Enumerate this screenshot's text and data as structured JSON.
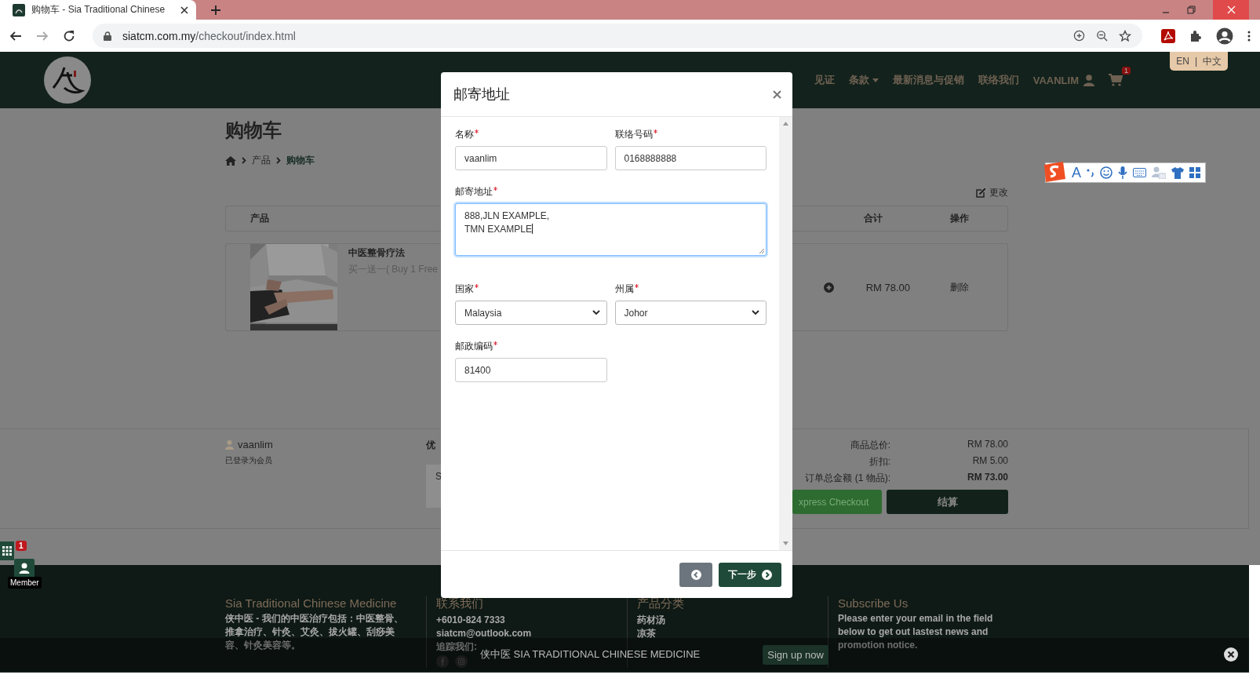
{
  "browser": {
    "tab_title": "购物车 - Sia Traditional Chinese",
    "url_host": "siatcm.com.my",
    "url_path": "/checkout/index.html"
  },
  "site_nav": {
    "items": [
      {
        "label": "见证",
        "dropdown": false
      },
      {
        "label": "条款",
        "dropdown": true
      },
      {
        "label": "最新消息与促销",
        "dropdown": false
      },
      {
        "label": "联络我们",
        "dropdown": false
      }
    ],
    "user": "VAANLIM",
    "cart_count": "1"
  },
  "language_switch": {
    "items": [
      "EN",
      "中文"
    ],
    "separator": "|"
  },
  "ime_toolbar": {
    "letter": "A"
  },
  "page": {
    "title": "购物车",
    "breadcrumb": [
      "产品",
      "购物车"
    ],
    "edit_link": "更改"
  },
  "cart_table": {
    "columns": [
      "产品",
      "合计",
      "操作"
    ],
    "rows": [
      {
        "name": "中医整骨疗法",
        "offer": "买一送一( Buy 1 Free",
        "total": "RM 78.00",
        "action": "删除"
      }
    ]
  },
  "summary": {
    "user": "vaanlim",
    "status": "已登录为会员",
    "coupon_label": "优",
    "coupon_box": "S",
    "lines": [
      {
        "label": "商品总价:",
        "value": "RM 78.00",
        "bold": false
      },
      {
        "label": "折扣:",
        "value": "RM 5.00",
        "bold": false
      },
      {
        "label": "订单总金额 (1 物品):",
        "value": "RM 73.00",
        "bold": true
      }
    ],
    "express_button": "xpress Checkout",
    "checkout_button": "结算"
  },
  "side_widget": {
    "badge": "1",
    "label": "Member"
  },
  "footer": {
    "columns": [
      {
        "title": "Sia Traditional Chinese Medicine",
        "lines": [
          "侠中医 - 我们的中医治疗包括：中医整骨、推拿治疗、针灸、艾灸、拔火罐、刮痧美容、针灸美容等。"
        ]
      },
      {
        "title": "联系我们",
        "lines": [
          "+6010-824 7333",
          "siatcm@outlook.com",
          "追踪我们:"
        ]
      },
      {
        "title": "产品分类",
        "lines": [
          "药材汤",
          "凉茶"
        ]
      },
      {
        "title": "Subscribe Us",
        "lines": [
          "Please enter your email in the field below to get out lastest news and promotion notice."
        ]
      }
    ]
  },
  "cookie_bar": {
    "text": "侠中医 SIA TRADITIONAL CHINESE MEDICINE",
    "button": "Sign up now"
  },
  "modal": {
    "title": "邮寄地址",
    "fields": [
      {
        "kind": "input",
        "label": "名称",
        "required": true,
        "value": "vaanlim",
        "focused": false
      },
      {
        "kind": "input",
        "label": "联络号码",
        "required": true,
        "value": "0168888888",
        "focused": false
      },
      {
        "kind": "textarea",
        "label": "邮寄地址",
        "required": true,
        "value": "888,JLN EXAMPLE,\nTMN EXAMPLE",
        "focused": true
      },
      {
        "kind": "select",
        "label": "国家",
        "required": true,
        "value": "Malaysia",
        "focused": false
      },
      {
        "kind": "select",
        "label": "州属",
        "required": true,
        "value": "Johor",
        "focused": false
      },
      {
        "kind": "input",
        "label": "邮政编码",
        "required": true,
        "value": "81400",
        "focused": false
      }
    ],
    "next_button": "下一步"
  }
}
